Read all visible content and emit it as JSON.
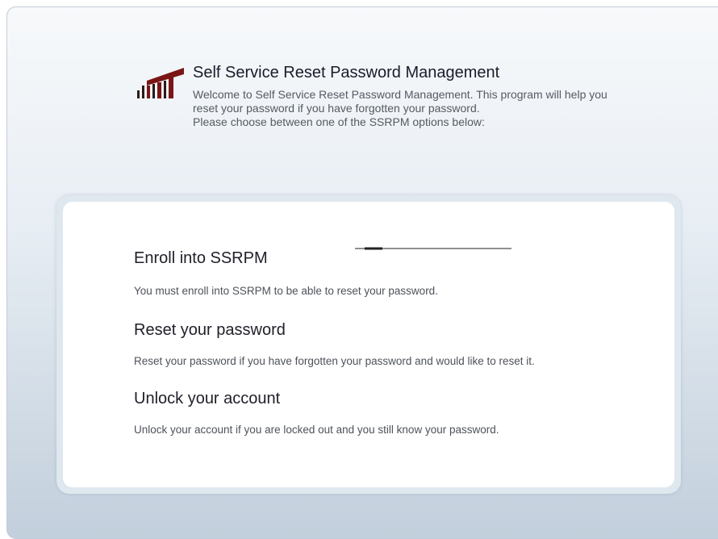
{
  "header": {
    "title": "Self Service Reset Password Management",
    "intro_line1": "Welcome to Self Service Reset Password Management. This program will help you reset your password if you have forgotten your password.",
    "intro_line2": "Please choose between one of the SSRPM options below:",
    "logo_icon": "company-logo-icon"
  },
  "options": [
    {
      "title": "Enroll into SSRPM",
      "description": "You must enroll into SSRPM to be able to reset your password."
    },
    {
      "title": "Reset your password",
      "description": "Reset your password if you have forgotten your password and would like to reset it."
    },
    {
      "title": "Unlock your account",
      "description": "Unlock your account if you are locked out and you still know your password."
    }
  ],
  "colors": {
    "logo_red": "#7a1616",
    "logo_dark": "#2a1a1a",
    "title_text": "#1b1b2b",
    "body_text": "#555b62"
  }
}
